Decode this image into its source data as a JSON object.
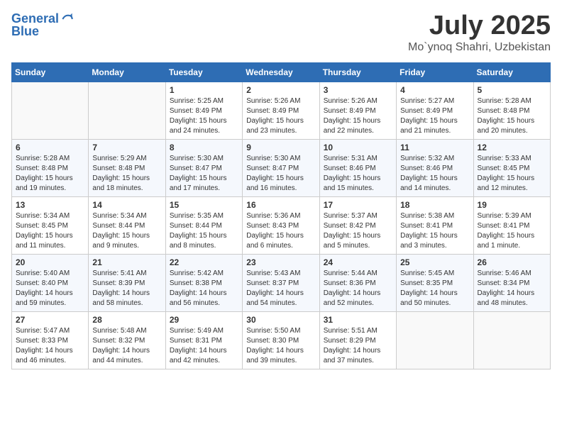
{
  "header": {
    "logo_line1": "General",
    "logo_line2": "Blue",
    "month_title": "July 2025",
    "location": "Mo`ynoq Shahri, Uzbekistan"
  },
  "weekdays": [
    "Sunday",
    "Monday",
    "Tuesday",
    "Wednesday",
    "Thursday",
    "Friday",
    "Saturday"
  ],
  "rows": [
    [
      {
        "day": "",
        "text": ""
      },
      {
        "day": "",
        "text": ""
      },
      {
        "day": "1",
        "text": "Sunrise: 5:25 AM\nSunset: 8:49 PM\nDaylight: 15 hours\nand 24 minutes."
      },
      {
        "day": "2",
        "text": "Sunrise: 5:26 AM\nSunset: 8:49 PM\nDaylight: 15 hours\nand 23 minutes."
      },
      {
        "day": "3",
        "text": "Sunrise: 5:26 AM\nSunset: 8:49 PM\nDaylight: 15 hours\nand 22 minutes."
      },
      {
        "day": "4",
        "text": "Sunrise: 5:27 AM\nSunset: 8:49 PM\nDaylight: 15 hours\nand 21 minutes."
      },
      {
        "day": "5",
        "text": "Sunrise: 5:28 AM\nSunset: 8:48 PM\nDaylight: 15 hours\nand 20 minutes."
      }
    ],
    [
      {
        "day": "6",
        "text": "Sunrise: 5:28 AM\nSunset: 8:48 PM\nDaylight: 15 hours\nand 19 minutes."
      },
      {
        "day": "7",
        "text": "Sunrise: 5:29 AM\nSunset: 8:48 PM\nDaylight: 15 hours\nand 18 minutes."
      },
      {
        "day": "8",
        "text": "Sunrise: 5:30 AM\nSunset: 8:47 PM\nDaylight: 15 hours\nand 17 minutes."
      },
      {
        "day": "9",
        "text": "Sunrise: 5:30 AM\nSunset: 8:47 PM\nDaylight: 15 hours\nand 16 minutes."
      },
      {
        "day": "10",
        "text": "Sunrise: 5:31 AM\nSunset: 8:46 PM\nDaylight: 15 hours\nand 15 minutes."
      },
      {
        "day": "11",
        "text": "Sunrise: 5:32 AM\nSunset: 8:46 PM\nDaylight: 15 hours\nand 14 minutes."
      },
      {
        "day": "12",
        "text": "Sunrise: 5:33 AM\nSunset: 8:45 PM\nDaylight: 15 hours\nand 12 minutes."
      }
    ],
    [
      {
        "day": "13",
        "text": "Sunrise: 5:34 AM\nSunset: 8:45 PM\nDaylight: 15 hours\nand 11 minutes."
      },
      {
        "day": "14",
        "text": "Sunrise: 5:34 AM\nSunset: 8:44 PM\nDaylight: 15 hours\nand 9 minutes."
      },
      {
        "day": "15",
        "text": "Sunrise: 5:35 AM\nSunset: 8:44 PM\nDaylight: 15 hours\nand 8 minutes."
      },
      {
        "day": "16",
        "text": "Sunrise: 5:36 AM\nSunset: 8:43 PM\nDaylight: 15 hours\nand 6 minutes."
      },
      {
        "day": "17",
        "text": "Sunrise: 5:37 AM\nSunset: 8:42 PM\nDaylight: 15 hours\nand 5 minutes."
      },
      {
        "day": "18",
        "text": "Sunrise: 5:38 AM\nSunset: 8:41 PM\nDaylight: 15 hours\nand 3 minutes."
      },
      {
        "day": "19",
        "text": "Sunrise: 5:39 AM\nSunset: 8:41 PM\nDaylight: 15 hours\nand 1 minute."
      }
    ],
    [
      {
        "day": "20",
        "text": "Sunrise: 5:40 AM\nSunset: 8:40 PM\nDaylight: 14 hours\nand 59 minutes."
      },
      {
        "day": "21",
        "text": "Sunrise: 5:41 AM\nSunset: 8:39 PM\nDaylight: 14 hours\nand 58 minutes."
      },
      {
        "day": "22",
        "text": "Sunrise: 5:42 AM\nSunset: 8:38 PM\nDaylight: 14 hours\nand 56 minutes."
      },
      {
        "day": "23",
        "text": "Sunrise: 5:43 AM\nSunset: 8:37 PM\nDaylight: 14 hours\nand 54 minutes."
      },
      {
        "day": "24",
        "text": "Sunrise: 5:44 AM\nSunset: 8:36 PM\nDaylight: 14 hours\nand 52 minutes."
      },
      {
        "day": "25",
        "text": "Sunrise: 5:45 AM\nSunset: 8:35 PM\nDaylight: 14 hours\nand 50 minutes."
      },
      {
        "day": "26",
        "text": "Sunrise: 5:46 AM\nSunset: 8:34 PM\nDaylight: 14 hours\nand 48 minutes."
      }
    ],
    [
      {
        "day": "27",
        "text": "Sunrise: 5:47 AM\nSunset: 8:33 PM\nDaylight: 14 hours\nand 46 minutes."
      },
      {
        "day": "28",
        "text": "Sunrise: 5:48 AM\nSunset: 8:32 PM\nDaylight: 14 hours\nand 44 minutes."
      },
      {
        "day": "29",
        "text": "Sunrise: 5:49 AM\nSunset: 8:31 PM\nDaylight: 14 hours\nand 42 minutes."
      },
      {
        "day": "30",
        "text": "Sunrise: 5:50 AM\nSunset: 8:30 PM\nDaylight: 14 hours\nand 39 minutes."
      },
      {
        "day": "31",
        "text": "Sunrise: 5:51 AM\nSunset: 8:29 PM\nDaylight: 14 hours\nand 37 minutes."
      },
      {
        "day": "",
        "text": ""
      },
      {
        "day": "",
        "text": ""
      }
    ]
  ]
}
